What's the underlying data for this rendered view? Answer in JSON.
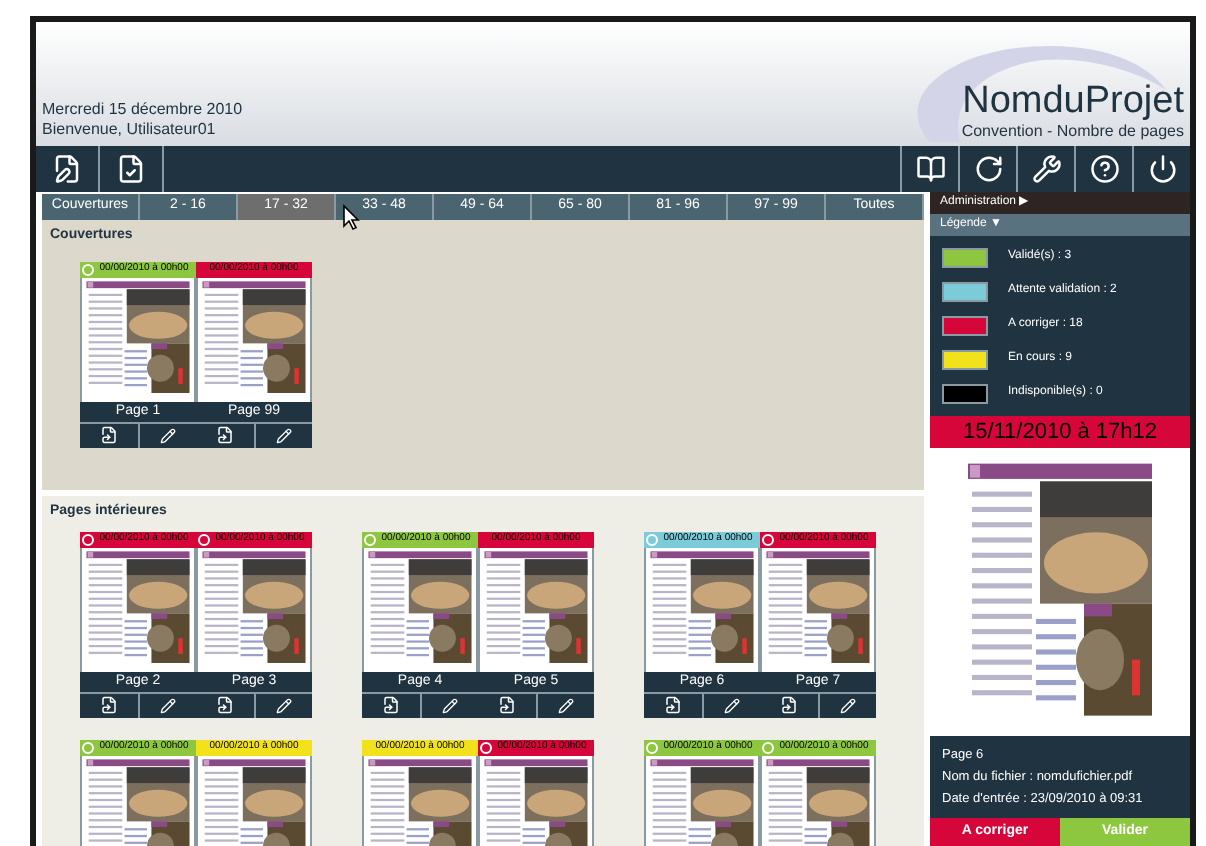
{
  "header": {
    "date": "Mercredi 15 décembre 2010",
    "welcome": "Bienvenue, Utilisateur01",
    "project": "NomduProjet",
    "subtitle": "Convention - Nombre de pages"
  },
  "tabs": [
    {
      "label": "Couvertures",
      "selected": false
    },
    {
      "label": "2 - 16",
      "selected": false
    },
    {
      "label": "17 - 32",
      "selected": true
    },
    {
      "label": "33 - 48",
      "selected": false
    },
    {
      "label": "49 - 64",
      "selected": false
    },
    {
      "label": "65 - 80",
      "selected": false
    },
    {
      "label": "81 - 96",
      "selected": false
    },
    {
      "label": "97 - 99",
      "selected": false
    },
    {
      "label": "Toutes",
      "selected": false
    }
  ],
  "covers": {
    "title": "Couvertures",
    "spreads": [
      {
        "pages": [
          {
            "date": "00/00/2010 à 00h00",
            "color": "#8dc63f",
            "flag": true,
            "label": "Page 1"
          },
          {
            "date": "00/00/2010 à 00h00",
            "color": "#d7063a",
            "flag": false,
            "label": "Page 99"
          }
        ]
      }
    ]
  },
  "interior": {
    "title": "Pages intérieures",
    "spreads": [
      {
        "pages": [
          {
            "date": "00/00/2010 à 00h00",
            "color": "#d7063a",
            "flag": true,
            "label": "Page 2"
          },
          {
            "date": "00/00/2010 à 00h00",
            "color": "#d7063a",
            "flag": true,
            "label": "Page 3"
          }
        ]
      },
      {
        "pages": [
          {
            "date": "00/00/2010 à 00h00",
            "color": "#8dc63f",
            "flag": true,
            "label": "Page 4"
          },
          {
            "date": "00/00/2010 à 00h00",
            "color": "#d7063a",
            "flag": false,
            "label": "Page 5"
          }
        ]
      },
      {
        "pages": [
          {
            "date": "00/00/2010 à 00h00",
            "color": "#7ccbd9",
            "flag": true,
            "label": "Page 6"
          },
          {
            "date": "00/00/2010 à 00h00",
            "color": "#d7063a",
            "flag": true,
            "label": "Page 7"
          }
        ]
      },
      {
        "pages": [
          {
            "date": "00/00/2010 à 00h00",
            "color": "#8dc63f",
            "flag": true
          },
          {
            "date": "00/00/2010 à 00h00",
            "color": "#f2e21b",
            "flag": false
          }
        ]
      },
      {
        "pages": [
          {
            "date": "00/00/2010 à 00h00",
            "color": "#f2e21b",
            "flag": false
          },
          {
            "date": "00/00/2010 à 00h00",
            "color": "#d7063a",
            "flag": true
          }
        ]
      },
      {
        "pages": [
          {
            "date": "00/00/2010 à 00h00",
            "color": "#8dc63f",
            "flag": true
          },
          {
            "date": "00/00/2010 à 00h00",
            "color": "#8dc63f",
            "flag": true
          }
        ]
      }
    ]
  },
  "sidebar": {
    "admin": "Administration ▶",
    "legend_title": "Légende ▼",
    "legend": [
      {
        "label": "Validé(s) : 3",
        "color": "#8dc63f"
      },
      {
        "label": "Attente validation : 2",
        "color": "#7ccbd9"
      },
      {
        "label": "A corriger : 18",
        "color": "#d7063a"
      },
      {
        "label": "En cours : 9",
        "color": "#f2e21b"
      },
      {
        "label": "Indisponible(s) : 0",
        "color": "#000000"
      }
    ],
    "banner": "15/11/2010 à 17h12",
    "info": [
      "Page 6",
      "Nom du fichier : nomdufichier.pdf",
      "Date d'entrée : 23/09/2010 à 09:31"
    ],
    "buttons": [
      {
        "label": "A corriger",
        "kind": "reject"
      },
      {
        "label": "Valider",
        "kind": "accept"
      }
    ]
  }
}
